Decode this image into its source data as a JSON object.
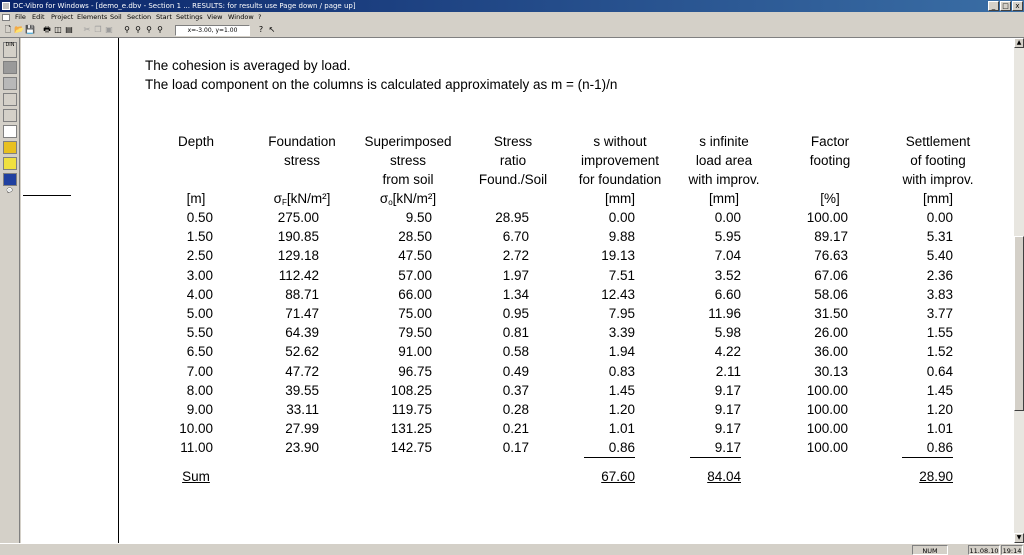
{
  "window": {
    "title": "DC-Vibro for Windows - [demo_e.dbv - Section 1 ... RESULTS: for results use Page down / page up]",
    "buttons": {
      "minimize": "_",
      "maximize": "□",
      "close": "x"
    }
  },
  "menu": {
    "items": [
      "File",
      "Edit",
      "Project",
      "Elements",
      "Soil",
      "Section",
      "Start",
      "Settings",
      "View",
      "Window",
      "?"
    ]
  },
  "toolbar": {
    "coords": "x=-3.00, y=1.00",
    "icons": [
      "new-icon",
      "open-icon",
      "save-icon",
      "print-icon",
      "preview-icon",
      "page-icon",
      "cut-icon",
      "copy-icon",
      "paste-icon",
      "zoom-icons",
      "help-icon"
    ]
  },
  "left_toolbar": {
    "din_label": "DIN"
  },
  "notes": {
    "line1": "The cohesion is averaged by load.",
    "line2": "The load component on the columns is calculated approximately as m = (n-1)/n"
  },
  "table": {
    "headers": [
      [
        "Depth"
      ],
      [
        "Foundation",
        "stress"
      ],
      [
        "Superimposed",
        "stress",
        "from soil"
      ],
      [
        "Stress",
        "ratio",
        "Found./Soil"
      ],
      [
        "s without",
        "improvement",
        "for foundation"
      ],
      [
        "s infinite",
        "load area",
        "with improv."
      ],
      [
        "Factor",
        "footing"
      ],
      [
        "Settlement",
        "of footing",
        "with improv."
      ]
    ],
    "units": [
      "[m]",
      "[kN/m²]",
      "[kN/m²]",
      "",
      "[mm]",
      "[mm]",
      "[%]",
      "[mm]"
    ],
    "unit_symbols": {
      "sigma": "σ",
      "sub_f": "F",
      "sub_o": "o"
    },
    "rows": [
      [
        "0.50",
        "275.00",
        "9.50",
        "28.95",
        "0.00",
        "0.00",
        "100.00",
        "0.00"
      ],
      [
        "1.50",
        "190.85",
        "28.50",
        "6.70",
        "9.88",
        "5.95",
        "89.17",
        "5.31"
      ],
      [
        "2.50",
        "129.18",
        "47.50",
        "2.72",
        "19.13",
        "7.04",
        "76.63",
        "5.40"
      ],
      [
        "3.00",
        "112.42",
        "57.00",
        "1.97",
        "7.51",
        "3.52",
        "67.06",
        "2.36"
      ],
      [
        "4.00",
        "88.71",
        "66.00",
        "1.34",
        "12.43",
        "6.60",
        "58.06",
        "3.83"
      ],
      [
        "5.00",
        "71.47",
        "75.00",
        "0.95",
        "7.95",
        "11.96",
        "31.50",
        "3.77"
      ],
      [
        "5.50",
        "64.39",
        "79.50",
        "0.81",
        "3.39",
        "5.98",
        "26.00",
        "1.55"
      ],
      [
        "6.50",
        "52.62",
        "91.00",
        "0.58",
        "1.94",
        "4.22",
        "36.00",
        "1.52"
      ],
      [
        "7.00",
        "47.72",
        "96.75",
        "0.49",
        "0.83",
        "2.11",
        "30.13",
        "0.64"
      ],
      [
        "8.00",
        "39.55",
        "108.25",
        "0.37",
        "1.45",
        "9.17",
        "100.00",
        "1.45"
      ],
      [
        "9.00",
        "33.11",
        "119.75",
        "0.28",
        "1.20",
        "9.17",
        "100.00",
        "1.20"
      ],
      [
        "10.00",
        "27.99",
        "131.25",
        "0.21",
        "1.01",
        "9.17",
        "100.00",
        "1.01"
      ],
      [
        "11.00",
        "23.90",
        "142.75",
        "0.17",
        "0.86",
        "9.17",
        "100.00",
        "0.86"
      ]
    ],
    "sum": {
      "label": "Sum",
      "s_without": "67.60",
      "s_infinite": "84.04",
      "settlement": "28.90"
    }
  },
  "status": {
    "num": "NUM",
    "date": "11.08.10",
    "time": "19:14"
  }
}
